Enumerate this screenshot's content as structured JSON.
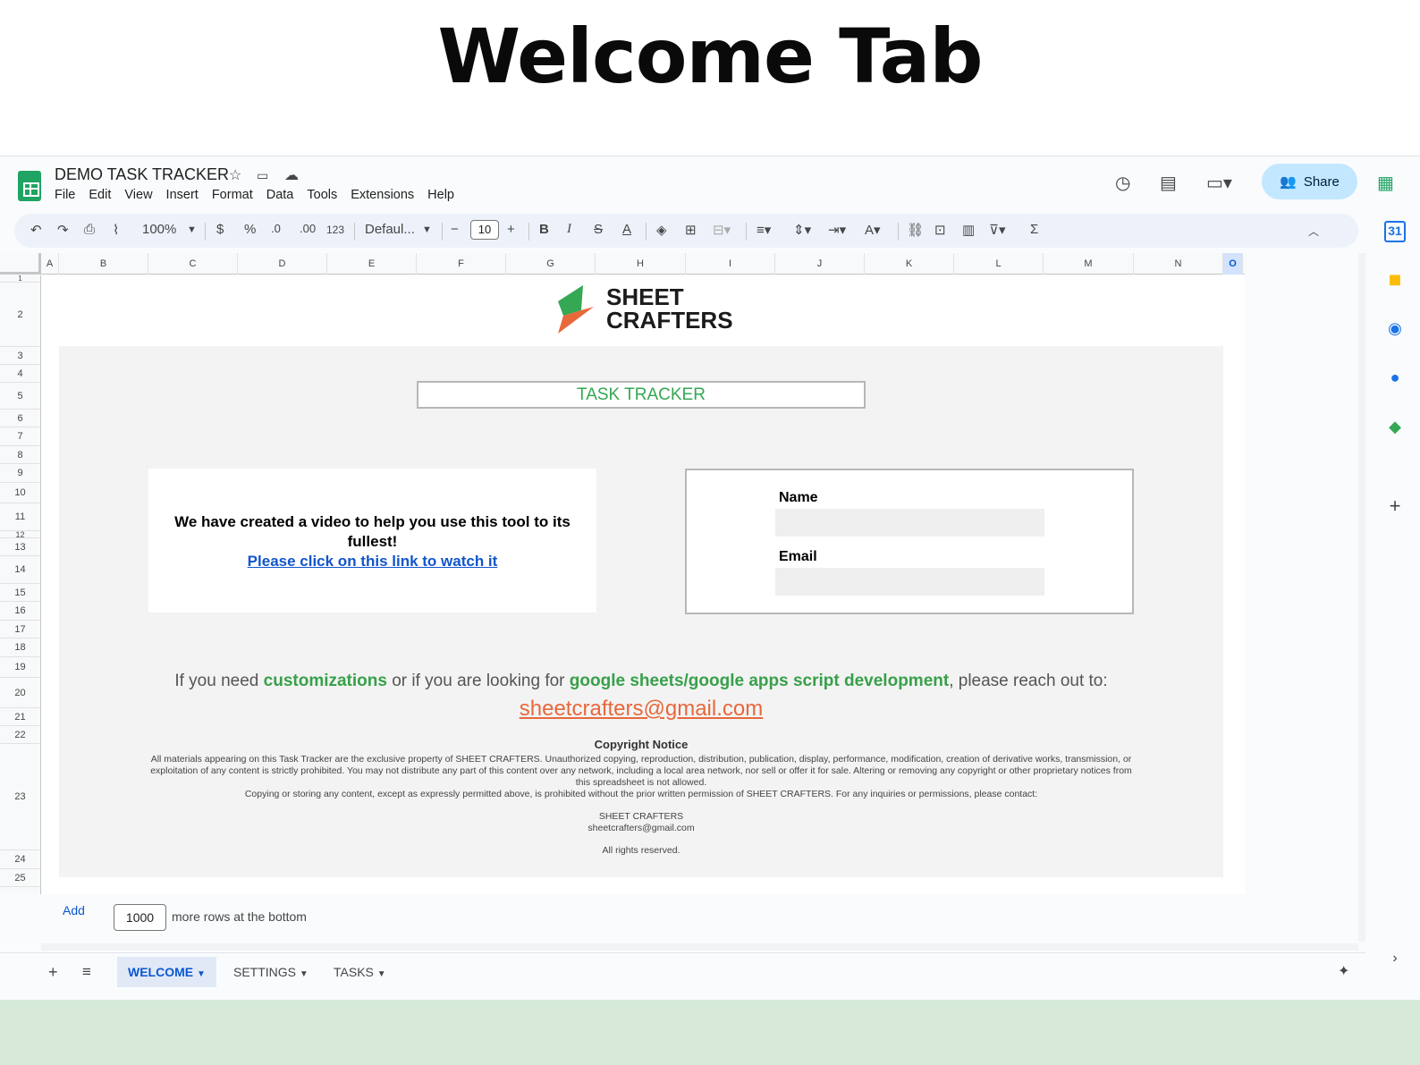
{
  "slide": {
    "heading": "Welcome Tab"
  },
  "doc": {
    "title": "DEMO TASK TRACKER"
  },
  "menu": [
    "File",
    "Edit",
    "View",
    "Insert",
    "Format",
    "Data",
    "Tools",
    "Extensions",
    "Help"
  ],
  "share_label": "Share",
  "toolbar": {
    "zoom": "100%",
    "currency": "$",
    "percent": "%",
    "dec_decrease": ".0",
    "dec_increase": ".00",
    "number_format": "123",
    "font": "Defaul...",
    "font_size": "10"
  },
  "columns": [
    "A",
    "B",
    "C",
    "D",
    "E",
    "F",
    "G",
    "H",
    "I",
    "J",
    "K",
    "L",
    "M",
    "N",
    "O"
  ],
  "rows": [
    "1",
    "2",
    "3",
    "4",
    "5",
    "6",
    "7",
    "8",
    "9",
    "10",
    "11",
    "12",
    "13",
    "14",
    "15",
    "16",
    "17",
    "18",
    "19",
    "20",
    "21",
    "22",
    "23",
    "24",
    "25"
  ],
  "logo": {
    "line1": "SHEET",
    "line2": "CRAFTERS"
  },
  "tracker_title": "TASK TRACKER",
  "video": {
    "text": "We have created a video to help you use this tool to its fullest!",
    "link": "Please click on this link to watch it"
  },
  "form": {
    "name_label": "Name",
    "email_label": "Email"
  },
  "reach": {
    "p1": "If you need ",
    "b1": "customizations",
    "p2": " or if you are looking for ",
    "b2": "google sheets/google apps script development",
    "p3": ", please reach out to:"
  },
  "contact_email": "sheetcrafters@gmail.com",
  "copyright": {
    "title": "Copyright Notice",
    "body1": "All materials appearing on this Task Tracker are the exclusive property of SHEET CRAFTERS. Unauthorized copying, reproduction, distribution, publication, display, performance, modification, creation of derivative works, transmission, or exploitation of any content is strictly prohibited. You may not distribute any part of this content over any network, including a local area network, nor sell or offer it for sale. Altering or removing any copyright or other proprietary notices from this spreadsheet is not allowed.",
    "body2": "Copying or storing any content, except as expressly permitted above, is prohibited without the prior written permission of SHEET CRAFTERS. For any inquiries or permissions, please contact:",
    "company": "SHEET CRAFTERS",
    "email": "sheetcrafters@gmail.com",
    "rights": "All rights reserved."
  },
  "add_rows": {
    "button": "Add",
    "count": "1000",
    "suffix": "more rows at the bottom"
  },
  "tabs": [
    "WELCOME",
    "SETTINGS",
    "TASKS"
  ],
  "colors": {
    "green": "#34a853",
    "orange": "#e8683b",
    "link": "#1155cc",
    "share_bg": "#c2e7ff"
  }
}
